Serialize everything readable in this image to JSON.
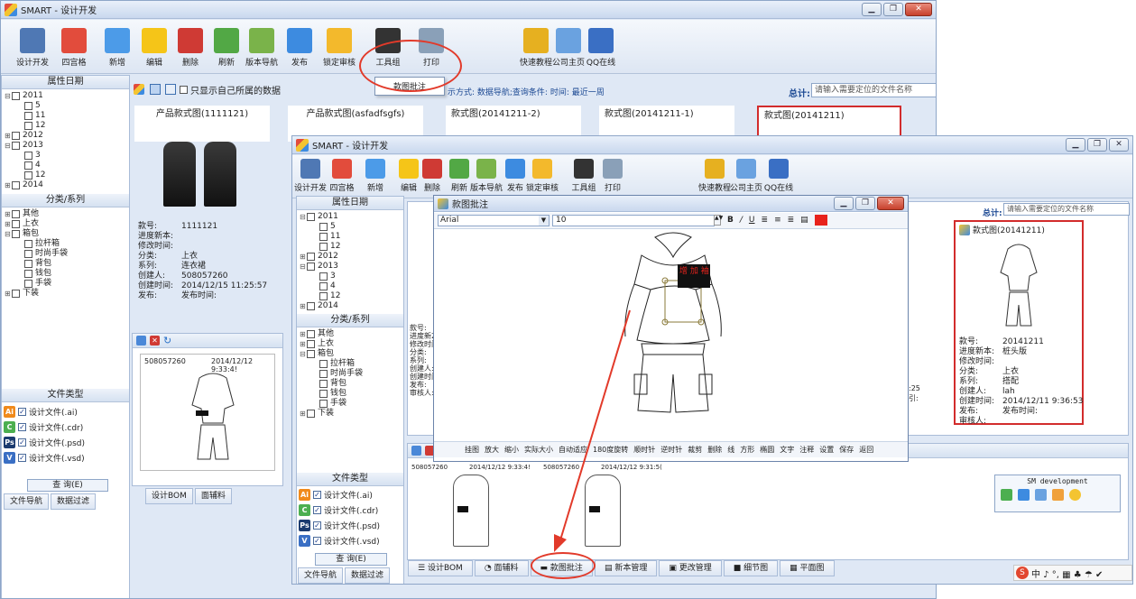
{
  "back_window": {
    "title": "SMART - 设计开发",
    "toolbar": [
      "设计开发",
      "四宫格",
      "新增",
      "编辑",
      "删除",
      "刷新",
      "版本导航",
      "发布",
      "锁定审核",
      "工具组",
      "打印",
      "快速教程",
      "公司主页",
      "QQ在线"
    ],
    "tool_menu_item": "款图批注",
    "left_panel": {
      "header": "属性日期",
      "tree": [
        {
          "label": "2011",
          "level": 0,
          "sign": "−"
        },
        {
          "label": "5",
          "level": 1
        },
        {
          "label": "11",
          "level": 1
        },
        {
          "label": "12",
          "level": 1
        },
        {
          "label": "2012",
          "level": 0,
          "sign": "+"
        },
        {
          "label": "2013",
          "level": 0,
          "sign": "−"
        },
        {
          "label": "3",
          "level": 1
        },
        {
          "label": "4",
          "level": 1
        },
        {
          "label": "12",
          "level": 1
        },
        {
          "label": "2014",
          "level": 0,
          "sign": "+"
        }
      ],
      "category_header": "分类/系列",
      "categories": [
        {
          "label": "其他",
          "level": 0,
          "sign": "+"
        },
        {
          "label": "上衣",
          "level": 0,
          "sign": "+"
        },
        {
          "label": "箱包",
          "level": 0,
          "sign": "−"
        },
        {
          "label": "拉杆箱",
          "level": 1
        },
        {
          "label": "时尚手袋",
          "level": 1
        },
        {
          "label": "背包",
          "level": 1
        },
        {
          "label": "钱包",
          "level": 1
        },
        {
          "label": "手袋",
          "level": 1
        },
        {
          "label": "下装",
          "level": 0,
          "sign": "+"
        }
      ],
      "filetype_header": "文件类型",
      "filetypes": [
        {
          "badge": "Ai",
          "label": "设计文件(.ai)",
          "color": "#f08a1c"
        },
        {
          "badge": "C",
          "label": "设计文件(.cdr)",
          "color": "#4caf50"
        },
        {
          "badge": "Ps",
          "label": "设计文件(.psd)",
          "color": "#1b3b6f"
        },
        {
          "badge": "V",
          "label": "设计文件(.vsd)",
          "color": "#3a6fc4"
        }
      ],
      "query_button": "查 询(E)",
      "bottom_tabs": [
        "文件导航",
        "数据过滤"
      ]
    },
    "filter_checkbox": "只显示自己所属的数据",
    "search_hint": "示方式: 数据导航;查询条件: 时间: 最近一周",
    "total_label": "总计:",
    "search_placeholder": "请输入需要定位的文件名称",
    "cards": [
      {
        "title": "产品款式图(1111121)"
      },
      {
        "title": "产品款式图(asfadfsgfs)"
      },
      {
        "title": "款式图(20141211-2)"
      },
      {
        "title": "款式图(20141211-1)"
      },
      {
        "title": "款式图(20141211)"
      }
    ],
    "detail": [
      [
        "款号:",
        "1111121"
      ],
      [
        "进度新本:",
        ""
      ],
      [
        "修改时间:",
        ""
      ],
      [
        "分类:",
        "上衣"
      ],
      [
        "系列:",
        "连衣裙"
      ],
      [
        "创建人:",
        "508057260"
      ],
      [
        "创建时间:",
        "2014/12/15 11:25:57"
      ],
      [
        "发布:",
        "发布时间:"
      ]
    ],
    "annot_row": {
      "user": "508057260",
      "time": "2014/12/12 9:33:4!"
    },
    "bottom_tabs": [
      "设计BOM",
      "面辅料"
    ]
  },
  "front_window": {
    "title": "SMART - 设计开发",
    "toolbar": [
      "设计开发",
      "四宫格",
      "新增",
      "编辑",
      "删除",
      "刷新",
      "版本导航",
      "发布",
      "锁定审核",
      "工具组",
      "打印",
      "快速教程",
      "公司主页",
      "QQ在线"
    ],
    "total_label": "总计:",
    "search_placeholder": "请输入需要定位的文件名称",
    "left_header": "属性日期",
    "category_header": "分类/系列",
    "filetype_header": "文件类型",
    "query_button": "查 询(E)",
    "bottom_left_tabs": [
      "文件导航",
      "数据过滤"
    ],
    "detail_left": [
      "款号:",
      "进度新2",
      "修改时间",
      "分类:",
      "系列:",
      "创建人:",
      "创建时间",
      "发布:",
      "审核人:"
    ],
    "right_card": {
      "title": "款式图(20141211)",
      "info": [
        [
          "款号:",
          "20141211"
        ],
        [
          "进度新本:",
          "桩头版"
        ],
        [
          "修改时间:",
          ""
        ],
        [
          "分类:",
          "上衣"
        ],
        [
          "系列:",
          "搭配"
        ],
        [
          "创建人:",
          "lah"
        ],
        [
          "创建时间:",
          "2014/12/11 9:36:53"
        ],
        [
          "发布:",
          "发布时间:"
        ],
        [
          "审核人:",
          ""
        ]
      ]
    },
    "right_time_fragments": [
      ":25",
      "引:"
    ],
    "thumbs": [
      {
        "user": "508057260",
        "time": "2014/12/12 9:33:4!"
      },
      {
        "user": "508057260",
        "time": "2014/12/12 9:31:5("
      }
    ],
    "dev_box": "SM development",
    "bottom_tabs": [
      "设计BOM",
      "面辅料",
      "款图批注",
      "新本管理",
      "更改管理",
      "细节图",
      "平面图"
    ],
    "ime_bar": "中 ♪ °, ▦ ♣ ☂ ✔"
  },
  "dialog": {
    "title": "款图批注",
    "font_name": "Arial",
    "font_size": "10",
    "format_buttons": [
      "B",
      "/",
      "U"
    ],
    "annotation_text": "增 加 袖",
    "toolbar_items": [
      "挂图",
      "放大",
      "缩小",
      "实际大小",
      "自动适应",
      "180度旋转",
      "顺时针",
      "逆时针",
      "裁剪",
      "删除",
      "线",
      "方形",
      "椭圆",
      "文字",
      "注释",
      "设置",
      "保存",
      "返回"
    ]
  }
}
